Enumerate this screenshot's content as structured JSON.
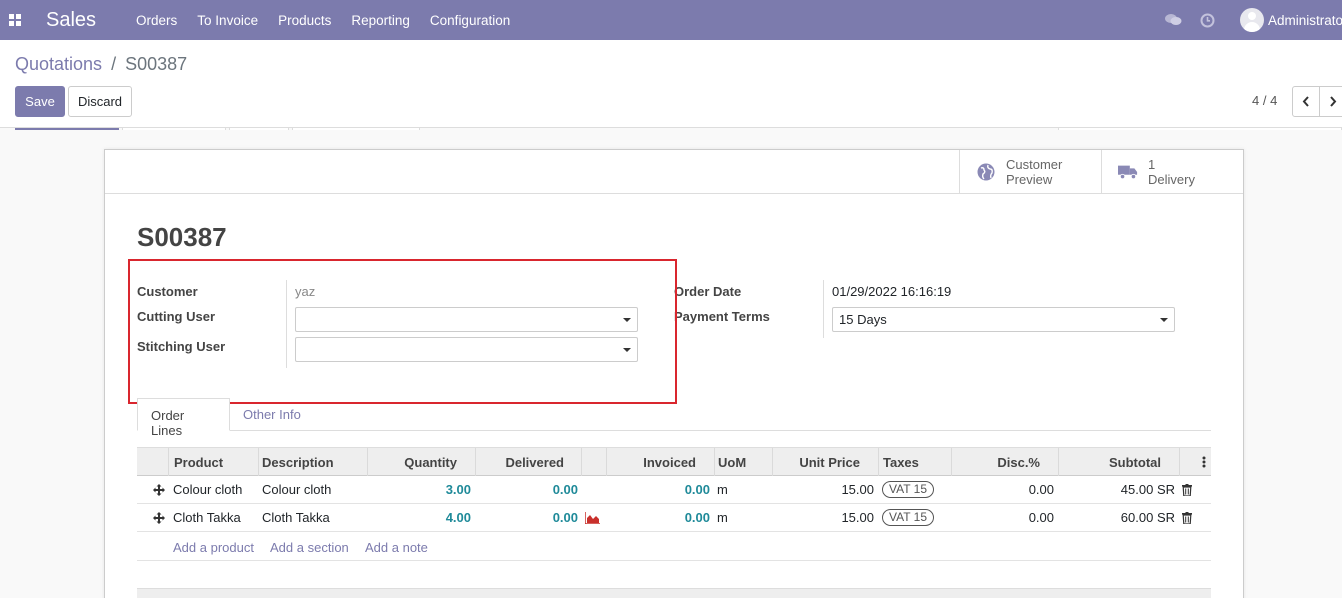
{
  "nav": {
    "app_name": "Sales",
    "menu": [
      "Orders",
      "To Invoice",
      "Products",
      "Reporting",
      "Configuration"
    ],
    "user": "Administrator"
  },
  "control": {
    "breadcrumb_parent": "Quotations",
    "breadcrumb_sep": "/",
    "breadcrumb_current": "S00387",
    "save_label": "Save",
    "discard_label": "Discard",
    "pager": "4 / 4"
  },
  "smart_buttons": {
    "preview_line1": "Customer",
    "preview_line2": "Preview",
    "delivery_count": "1",
    "delivery_label": "Delivery"
  },
  "form": {
    "title": "S00387",
    "customer_label": "Customer",
    "customer_value": "yaz",
    "cutting_user_label": "Cutting User",
    "cutting_user_value": "",
    "stitching_user_label": "Stitching User",
    "stitching_user_value": "",
    "order_date_label": "Order Date",
    "order_date_value": "01/29/2022 16:16:19",
    "payment_terms_label": "Payment Terms",
    "payment_terms_value": "15 Days"
  },
  "tabs": [
    "Order Lines",
    "Other Info"
  ],
  "table": {
    "columns": [
      "Product",
      "Description",
      "Quantity",
      "Delivered",
      "Invoiced",
      "UoM",
      "Unit Price",
      "Taxes",
      "Disc.%",
      "Subtotal"
    ],
    "rows": [
      {
        "product": "Colour cloth",
        "description": "Colour cloth",
        "quantity": "3.00",
        "delivered": "0.00",
        "invoiced": "0.00",
        "uom": "m",
        "unit_price": "15.00",
        "tax": "VAT 15",
        "disc": "0.00",
        "subtotal": "45.00 SR",
        "forecast_icon": false
      },
      {
        "product": "Cloth Takka",
        "description": "Cloth Takka",
        "quantity": "4.00",
        "delivered": "0.00",
        "invoiced": "0.00",
        "uom": "m",
        "unit_price": "15.00",
        "tax": "VAT 15",
        "disc": "0.00",
        "subtotal": "60.00 SR",
        "forecast_icon": true
      }
    ],
    "add_product": "Add a product",
    "add_section": "Add a section",
    "add_note": "Add a note"
  },
  "colors": {
    "primary": "#7c7bad",
    "highlight_box": "#d9262e",
    "link_number": "#1f8a99",
    "forecast_red": "#c9302c"
  }
}
